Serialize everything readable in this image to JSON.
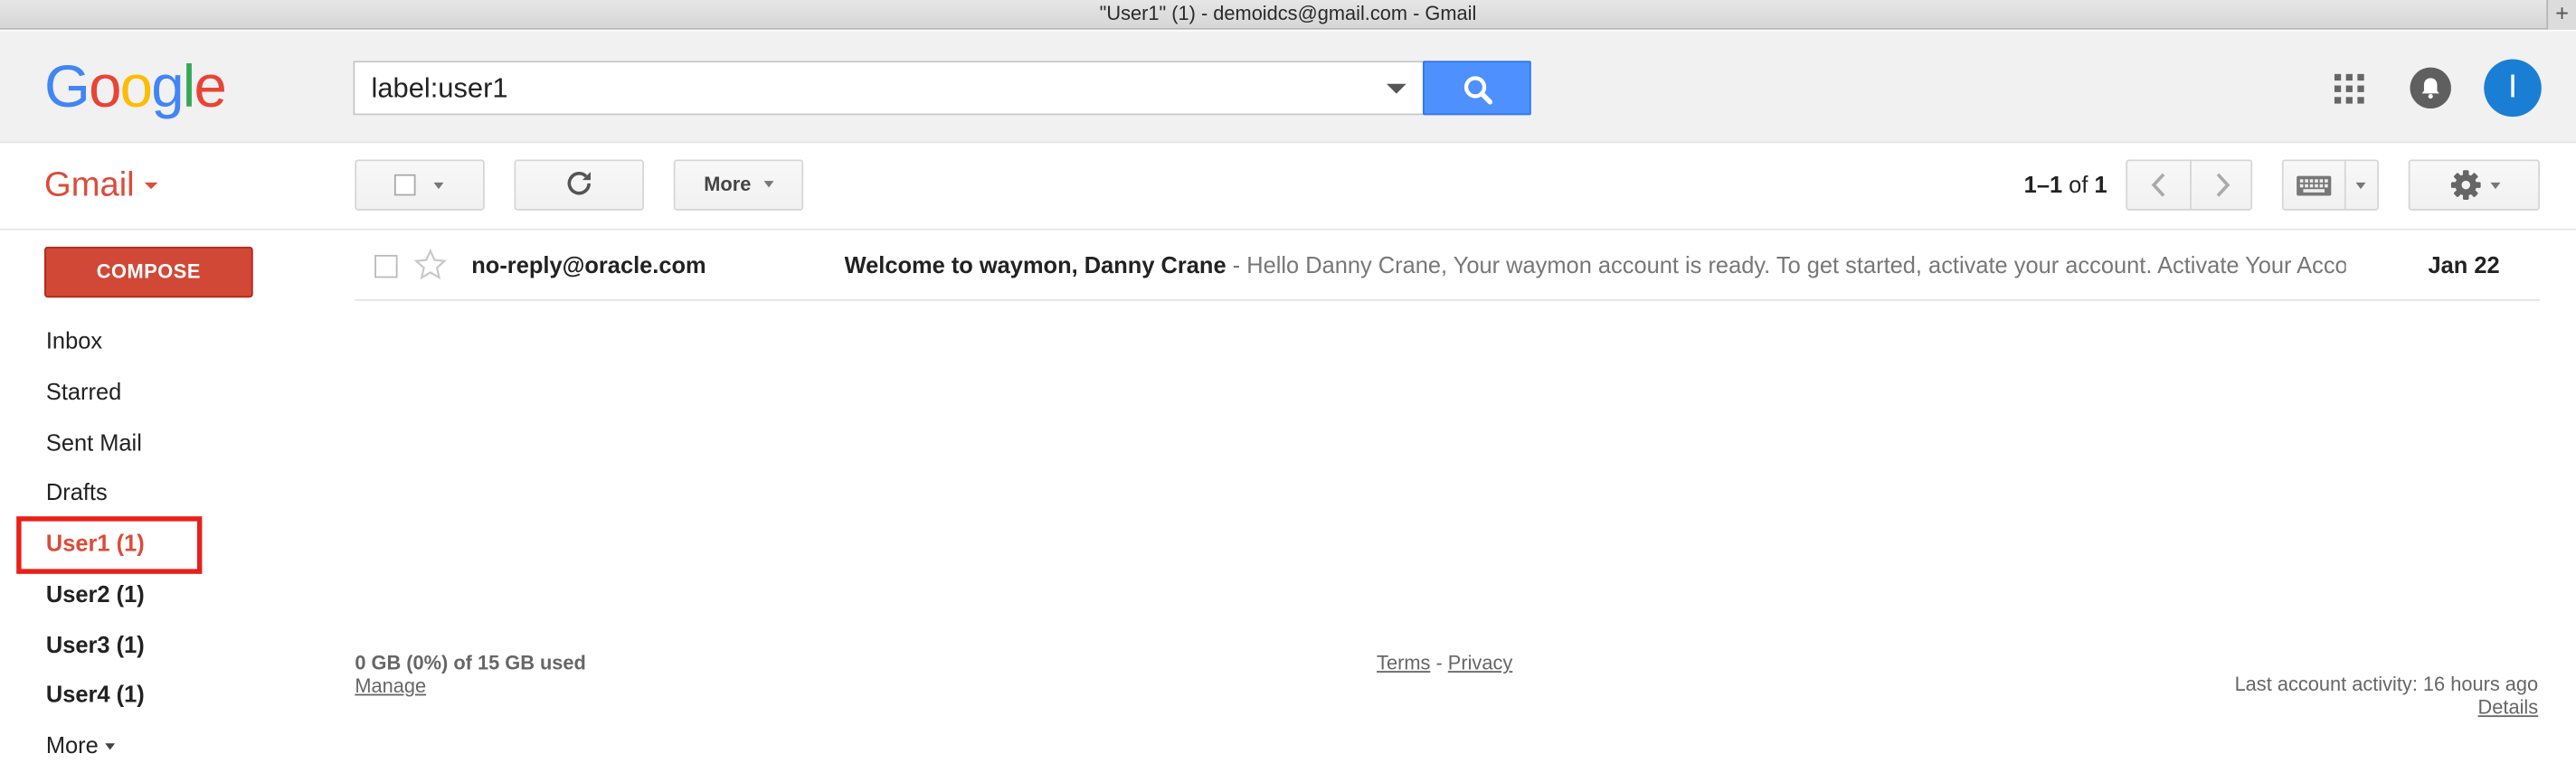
{
  "window": {
    "title": "\"User1\" (1) - demoidcs@gmail.com - Gmail"
  },
  "header": {
    "logo_letters": [
      {
        "ch": "G",
        "color": "#4285f4"
      },
      {
        "ch": "o",
        "color": "#ea4335"
      },
      {
        "ch": "o",
        "color": "#fbbc05"
      },
      {
        "ch": "g",
        "color": "#4285f4"
      },
      {
        "ch": "l",
        "color": "#34a853"
      },
      {
        "ch": "e",
        "color": "#ea4335"
      }
    ],
    "search_value": "label:user1",
    "avatar_initial": "I"
  },
  "toolbar": {
    "app_label": "Gmail",
    "more_label": "More",
    "page_range": "1–1",
    "page_of": "of",
    "page_total": "1"
  },
  "sidebar": {
    "compose_label": "COMPOSE",
    "items": [
      {
        "label": "Inbox"
      },
      {
        "label": "Starred"
      },
      {
        "label": "Sent Mail"
      },
      {
        "label": "Drafts"
      },
      {
        "label": "User1 (1)"
      },
      {
        "label": "User2 (1)"
      },
      {
        "label": "User3 (1)"
      },
      {
        "label": "User4 (1)"
      }
    ],
    "more_label": "More"
  },
  "messages": [
    {
      "sender": "no-reply@oracle.com",
      "subject": "Welcome to waymon, Danny Crane",
      "snippet": " - Hello Danny Crane, Your waymon account is ready. To get started, activate your account. Activate Your Account",
      "date": "Jan 22"
    }
  ],
  "footer": {
    "storage": "0 GB (0%) of 15 GB used",
    "manage": "Manage",
    "terms": "Terms",
    "separator": " - ",
    "privacy": "Privacy",
    "activity": "Last account activity: 16 hours ago",
    "details": "Details"
  },
  "colors": {
    "brand_red": "#dd4b39",
    "compose_red": "#d14836",
    "search_blue": "#4d90fe",
    "avatar_blue": "#1a7fd4",
    "highlight_red": "#e8201a"
  }
}
